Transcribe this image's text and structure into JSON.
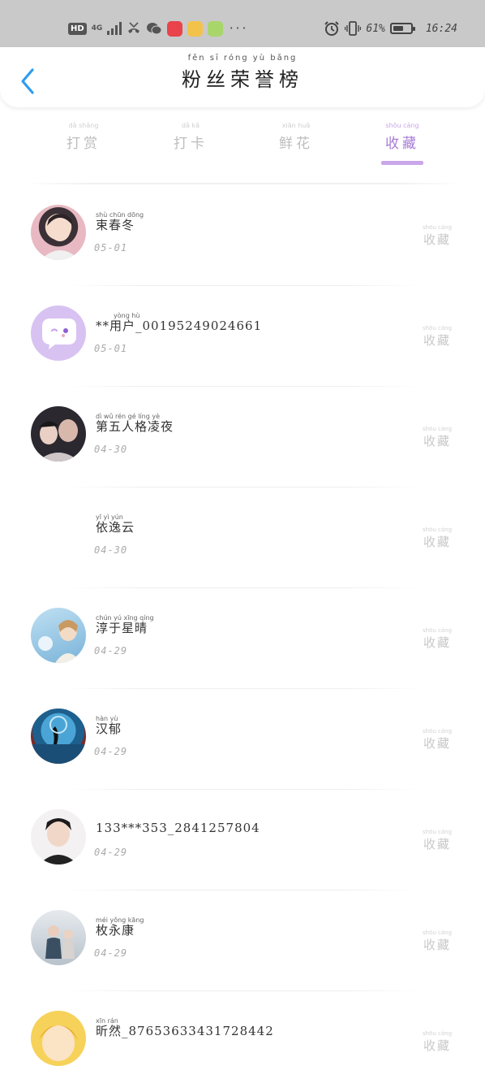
{
  "status_bar": {
    "hd": "HD",
    "network": "4G",
    "battery_percent": "61%",
    "battery_level": 0.61,
    "time": "16:24",
    "more": "···",
    "icons": [
      "signal-icon",
      "missed-call-icon",
      "wechat-icon",
      "notes-app-icon",
      "game-app-icon",
      "emoji-app-icon",
      "alarm-icon",
      "vibrate-icon",
      "battery-icon"
    ]
  },
  "header": {
    "title": "粉丝荣誉榜",
    "title_pinyin": "fěn sī róng yù bǎng",
    "back_icon": "chevron-left-icon",
    "accent_color": "#2f9cf0"
  },
  "tabs": [
    {
      "label": "打赏",
      "pinyin": "dǎ shǎng",
      "active": false
    },
    {
      "label": "打卡",
      "pinyin": "dǎ kǎ",
      "active": false
    },
    {
      "label": "鲜花",
      "pinyin": "xiān huā",
      "active": false
    },
    {
      "label": "收藏",
      "pinyin": "shōu cáng",
      "active": true
    }
  ],
  "active_color": "#a77bd6",
  "rows": [
    {
      "name": "束春冬",
      "pinyin": "shù chūn dōng",
      "date": "05-01",
      "action": "收藏",
      "action_pinyin": "shōu cáng",
      "avatar": "photo"
    },
    {
      "name": "**用户_00195249024661",
      "pinyin": "yòng hù",
      "date": "05-01",
      "action": "收藏",
      "action_pinyin": "shōu cáng",
      "avatar": "default"
    },
    {
      "name": "第五人格凌夜",
      "pinyin": "dì wǔ rén gé líng yè",
      "date": "04-30",
      "action": "收藏",
      "action_pinyin": "shōu cáng",
      "avatar": "photo"
    },
    {
      "name": "依逸云",
      "pinyin": "yī yì yún",
      "date": "04-30",
      "action": "收藏",
      "action_pinyin": "shōu cáng",
      "avatar": "none"
    },
    {
      "name": "淳于星晴",
      "pinyin": "chún yú xīng qíng",
      "date": "04-29",
      "action": "收藏",
      "action_pinyin": "shōu cáng",
      "avatar": "photo"
    },
    {
      "name": "汉郁",
      "pinyin": "hàn yù",
      "date": "04-29",
      "action": "收藏",
      "action_pinyin": "shōu cáng",
      "avatar": "photo"
    },
    {
      "name": "133***353_2841257804",
      "pinyin": "",
      "date": "04-29",
      "action": "收藏",
      "action_pinyin": "shōu cáng",
      "avatar": "photo"
    },
    {
      "name": "枚永康",
      "pinyin": "méi yǒng kāng",
      "date": "04-29",
      "action": "收藏",
      "action_pinyin": "shōu cáng",
      "avatar": "photo"
    },
    {
      "name": "昕然_87653633431728442",
      "pinyin": "xīn rán",
      "date": "",
      "action": "收藏",
      "action_pinyin": "shōu cáng",
      "avatar": "photo"
    }
  ]
}
